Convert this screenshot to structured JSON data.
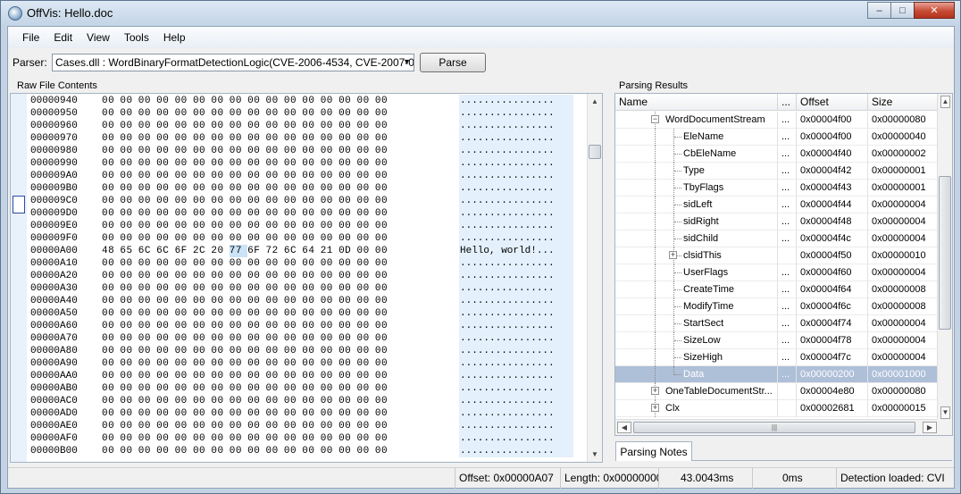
{
  "window": {
    "title": "OffVis: Hello.doc",
    "minimize": "‒",
    "maximize": "□",
    "close": "✕"
  },
  "menu": [
    "File",
    "Edit",
    "View",
    "Tools",
    "Help"
  ],
  "toolbar": {
    "parser_label": "Parser:",
    "parser_value": "Cases.dll : WordBinaryFormatDetectionLogic(CVE-2006-4534, CVE-2007-0515, C",
    "parse_button": "Parse"
  },
  "raw": {
    "label": "Raw File Contents",
    "rows": [
      {
        "addr": "00000940",
        "bytes": "00 00 00 00 00 00 00 00 00 00 00 00 00 00 00 00",
        "ascii": "................"
      },
      {
        "addr": "00000950",
        "bytes": "00 00 00 00 00 00 00 00 00 00 00 00 00 00 00 00",
        "ascii": "................"
      },
      {
        "addr": "00000960",
        "bytes": "00 00 00 00 00 00 00 00 00 00 00 00 00 00 00 00",
        "ascii": "................"
      },
      {
        "addr": "00000970",
        "bytes": "00 00 00 00 00 00 00 00 00 00 00 00 00 00 00 00",
        "ascii": "................"
      },
      {
        "addr": "00000980",
        "bytes": "00 00 00 00 00 00 00 00 00 00 00 00 00 00 00 00",
        "ascii": "................"
      },
      {
        "addr": "00000990",
        "bytes": "00 00 00 00 00 00 00 00 00 00 00 00 00 00 00 00",
        "ascii": "................"
      },
      {
        "addr": "000009A0",
        "bytes": "00 00 00 00 00 00 00 00 00 00 00 00 00 00 00 00",
        "ascii": "................"
      },
      {
        "addr": "000009B0",
        "bytes": "00 00 00 00 00 00 00 00 00 00 00 00 00 00 00 00",
        "ascii": "................"
      },
      {
        "addr": "000009C0",
        "bytes": "00 00 00 00 00 00 00 00 00 00 00 00 00 00 00 00",
        "ascii": "................"
      },
      {
        "addr": "000009D0",
        "bytes": "00 00 00 00 00 00 00 00 00 00 00 00 00 00 00 00",
        "ascii": "................"
      },
      {
        "addr": "000009E0",
        "bytes": "00 00 00 00 00 00 00 00 00 00 00 00 00 00 00 00",
        "ascii": "................"
      },
      {
        "addr": "000009F0",
        "bytes": "00 00 00 00 00 00 00 00 00 00 00 00 00 00 00 00",
        "ascii": "................"
      },
      {
        "addr": "00000A00",
        "bytes": "48 65 6C 6C 6F 2C 20 77 6F 72 6C 64 21 0D 00 00",
        "ascii": "Hello, world!...",
        "highlight": 7
      },
      {
        "addr": "00000A10",
        "bytes": "00 00 00 00 00 00 00 00 00 00 00 00 00 00 00 00",
        "ascii": "................"
      },
      {
        "addr": "00000A20",
        "bytes": "00 00 00 00 00 00 00 00 00 00 00 00 00 00 00 00",
        "ascii": "................"
      },
      {
        "addr": "00000A30",
        "bytes": "00 00 00 00 00 00 00 00 00 00 00 00 00 00 00 00",
        "ascii": "................"
      },
      {
        "addr": "00000A40",
        "bytes": "00 00 00 00 00 00 00 00 00 00 00 00 00 00 00 00",
        "ascii": "................"
      },
      {
        "addr": "00000A50",
        "bytes": "00 00 00 00 00 00 00 00 00 00 00 00 00 00 00 00",
        "ascii": "................"
      },
      {
        "addr": "00000A60",
        "bytes": "00 00 00 00 00 00 00 00 00 00 00 00 00 00 00 00",
        "ascii": "................"
      },
      {
        "addr": "00000A70",
        "bytes": "00 00 00 00 00 00 00 00 00 00 00 00 00 00 00 00",
        "ascii": "................"
      },
      {
        "addr": "00000A80",
        "bytes": "00 00 00 00 00 00 00 00 00 00 00 00 00 00 00 00",
        "ascii": "................"
      },
      {
        "addr": "00000A90",
        "bytes": "00 00 00 00 00 00 00 00 00 00 00 00 00 00 00 00",
        "ascii": "................"
      },
      {
        "addr": "00000AA0",
        "bytes": "00 00 00 00 00 00 00 00 00 00 00 00 00 00 00 00",
        "ascii": "................"
      },
      {
        "addr": "00000AB0",
        "bytes": "00 00 00 00 00 00 00 00 00 00 00 00 00 00 00 00",
        "ascii": "................"
      },
      {
        "addr": "00000AC0",
        "bytes": "00 00 00 00 00 00 00 00 00 00 00 00 00 00 00 00",
        "ascii": "................"
      },
      {
        "addr": "00000AD0",
        "bytes": "00 00 00 00 00 00 00 00 00 00 00 00 00 00 00 00",
        "ascii": "................"
      },
      {
        "addr": "00000AE0",
        "bytes": "00 00 00 00 00 00 00 00 00 00 00 00 00 00 00 00",
        "ascii": "................"
      },
      {
        "addr": "00000AF0",
        "bytes": "00 00 00 00 00 00 00 00 00 00 00 00 00 00 00 00",
        "ascii": "................"
      },
      {
        "addr": "00000B00",
        "bytes": "00 00 00 00 00 00 00 00 00 00 00 00 00 00 00 00",
        "ascii": "................"
      }
    ]
  },
  "results": {
    "label": "Parsing Results",
    "columns": [
      "Name",
      "...",
      "Offset",
      "Size"
    ],
    "rows": [
      {
        "name": "WordDocumentStream",
        "dots": "...",
        "offset": "0x00004f00",
        "size": "0x00000080",
        "depth": 0,
        "expander": "−"
      },
      {
        "name": "EleName",
        "dots": "...",
        "offset": "0x00004f00",
        "size": "0x00000040",
        "depth": 1
      },
      {
        "name": "CbEleName",
        "dots": "...",
        "offset": "0x00004f40",
        "size": "0x00000002",
        "depth": 1
      },
      {
        "name": "Type",
        "dots": "...",
        "offset": "0x00004f42",
        "size": "0x00000001",
        "depth": 1
      },
      {
        "name": "TbyFlags",
        "dots": "...",
        "offset": "0x00004f43",
        "size": "0x00000001",
        "depth": 1
      },
      {
        "name": "sidLeft",
        "dots": "...",
        "offset": "0x00004f44",
        "size": "0x00000004",
        "depth": 1
      },
      {
        "name": "sidRight",
        "dots": "...",
        "offset": "0x00004f48",
        "size": "0x00000004",
        "depth": 1
      },
      {
        "name": "sidChild",
        "dots": "...",
        "offset": "0x00004f4c",
        "size": "0x00000004",
        "depth": 1
      },
      {
        "name": "clsidThis",
        "dots": "",
        "offset": "0x00004f50",
        "size": "0x00000010",
        "depth": 1,
        "expander": "+"
      },
      {
        "name": "UserFlags",
        "dots": "...",
        "offset": "0x00004f60",
        "size": "0x00000004",
        "depth": 1
      },
      {
        "name": "CreateTime",
        "dots": "...",
        "offset": "0x00004f64",
        "size": "0x00000008",
        "depth": 1
      },
      {
        "name": "ModifyTime",
        "dots": "...",
        "offset": "0x00004f6c",
        "size": "0x00000008",
        "depth": 1
      },
      {
        "name": "StartSect",
        "dots": "...",
        "offset": "0x00004f74",
        "size": "0x00000004",
        "depth": 1
      },
      {
        "name": "SizeLow",
        "dots": "...",
        "offset": "0x00004f78",
        "size": "0x00000004",
        "depth": 1
      },
      {
        "name": "SizeHigh",
        "dots": "...",
        "offset": "0x00004f7c",
        "size": "0x00000004",
        "depth": 1
      },
      {
        "name": "Data",
        "dots": "...",
        "offset": "0x00000200",
        "size": "0x00001000",
        "depth": 1,
        "selected": true,
        "last": true
      },
      {
        "name": "OneTableDocumentStr...",
        "dots": "",
        "offset": "0x00004e80",
        "size": "0x00000080",
        "depth": 0,
        "expander": "+"
      },
      {
        "name": "Clx",
        "dots": "",
        "offset": "0x00002681",
        "size": "0x00000015",
        "depth": 0,
        "expander": "+"
      }
    ],
    "notes_tab": "Parsing Notes"
  },
  "status": {
    "offset": "Offset: 0x00000A07",
    "length": "Length: 0x00000000",
    "time1": "43.0043ms",
    "time2": "0ms",
    "detection": "Detection loaded: CVI"
  },
  "colors": {
    "selection": "#aebfd8",
    "hex_highlight": "#cbe3f7",
    "ascii_bg": "#e4f0fb",
    "close_button": "#c64b34"
  }
}
